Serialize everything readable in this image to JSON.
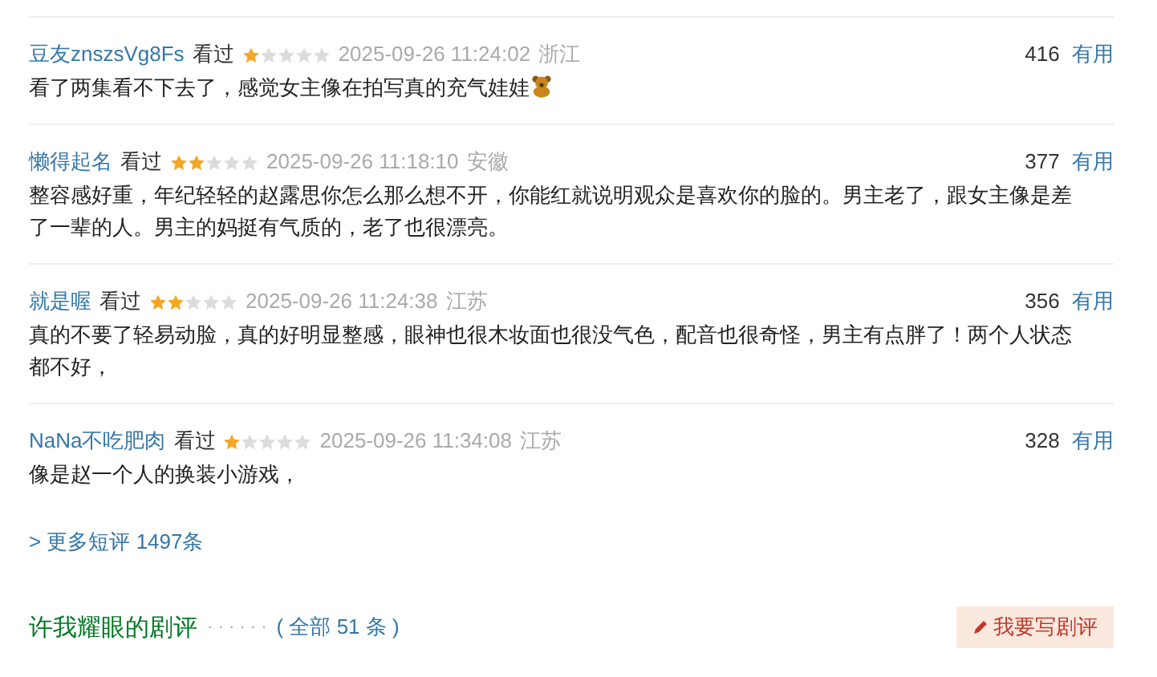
{
  "comments": [
    {
      "user": "豆友znszsVg8Fs",
      "status": "看过",
      "stars": 1,
      "time": "2025-09-26 11:24:02",
      "location": "浙江",
      "votes": "416",
      "vote_label": "有用",
      "text": "看了两集看不下去了，感觉女主像在拍写真的充气娃娃",
      "emoji": true
    },
    {
      "user": "懒得起名",
      "status": "看过",
      "stars": 2,
      "time": "2025-09-26 11:18:10",
      "location": "安徽",
      "votes": "377",
      "vote_label": "有用",
      "text": "整容感好重，年纪轻轻的赵露思你怎么那么想不开，你能红就说明观众是喜欢你的脸的。男主老了，跟女主像是差了一辈的人。男主的妈挺有气质的，老了也很漂亮。",
      "emoji": false
    },
    {
      "user": "就是喔",
      "status": "看过",
      "stars": 2,
      "time": "2025-09-26 11:24:38",
      "location": "江苏",
      "votes": "356",
      "vote_label": "有用",
      "text": "真的不要了轻易动脸，真的好明显整感，眼神也很木妆面也很没气色，配音也很奇怪，男主有点胖了！两个人状态都不好，",
      "emoji": false
    },
    {
      "user": "NaNa不吃肥肉",
      "status": "看过",
      "stars": 1,
      "time": "2025-09-26 11:34:08",
      "location": "江苏",
      "votes": "328",
      "vote_label": "有用",
      "text": "像是赵一个人的换装小游戏，",
      "emoji": false
    }
  ],
  "more_link": "> 更多短评 1497条",
  "section": {
    "title": "许我耀眼的剧评",
    "dots": "· · · · · ·",
    "count_link": "( 全部 51 条 )",
    "write_button": "我要写剧评"
  }
}
